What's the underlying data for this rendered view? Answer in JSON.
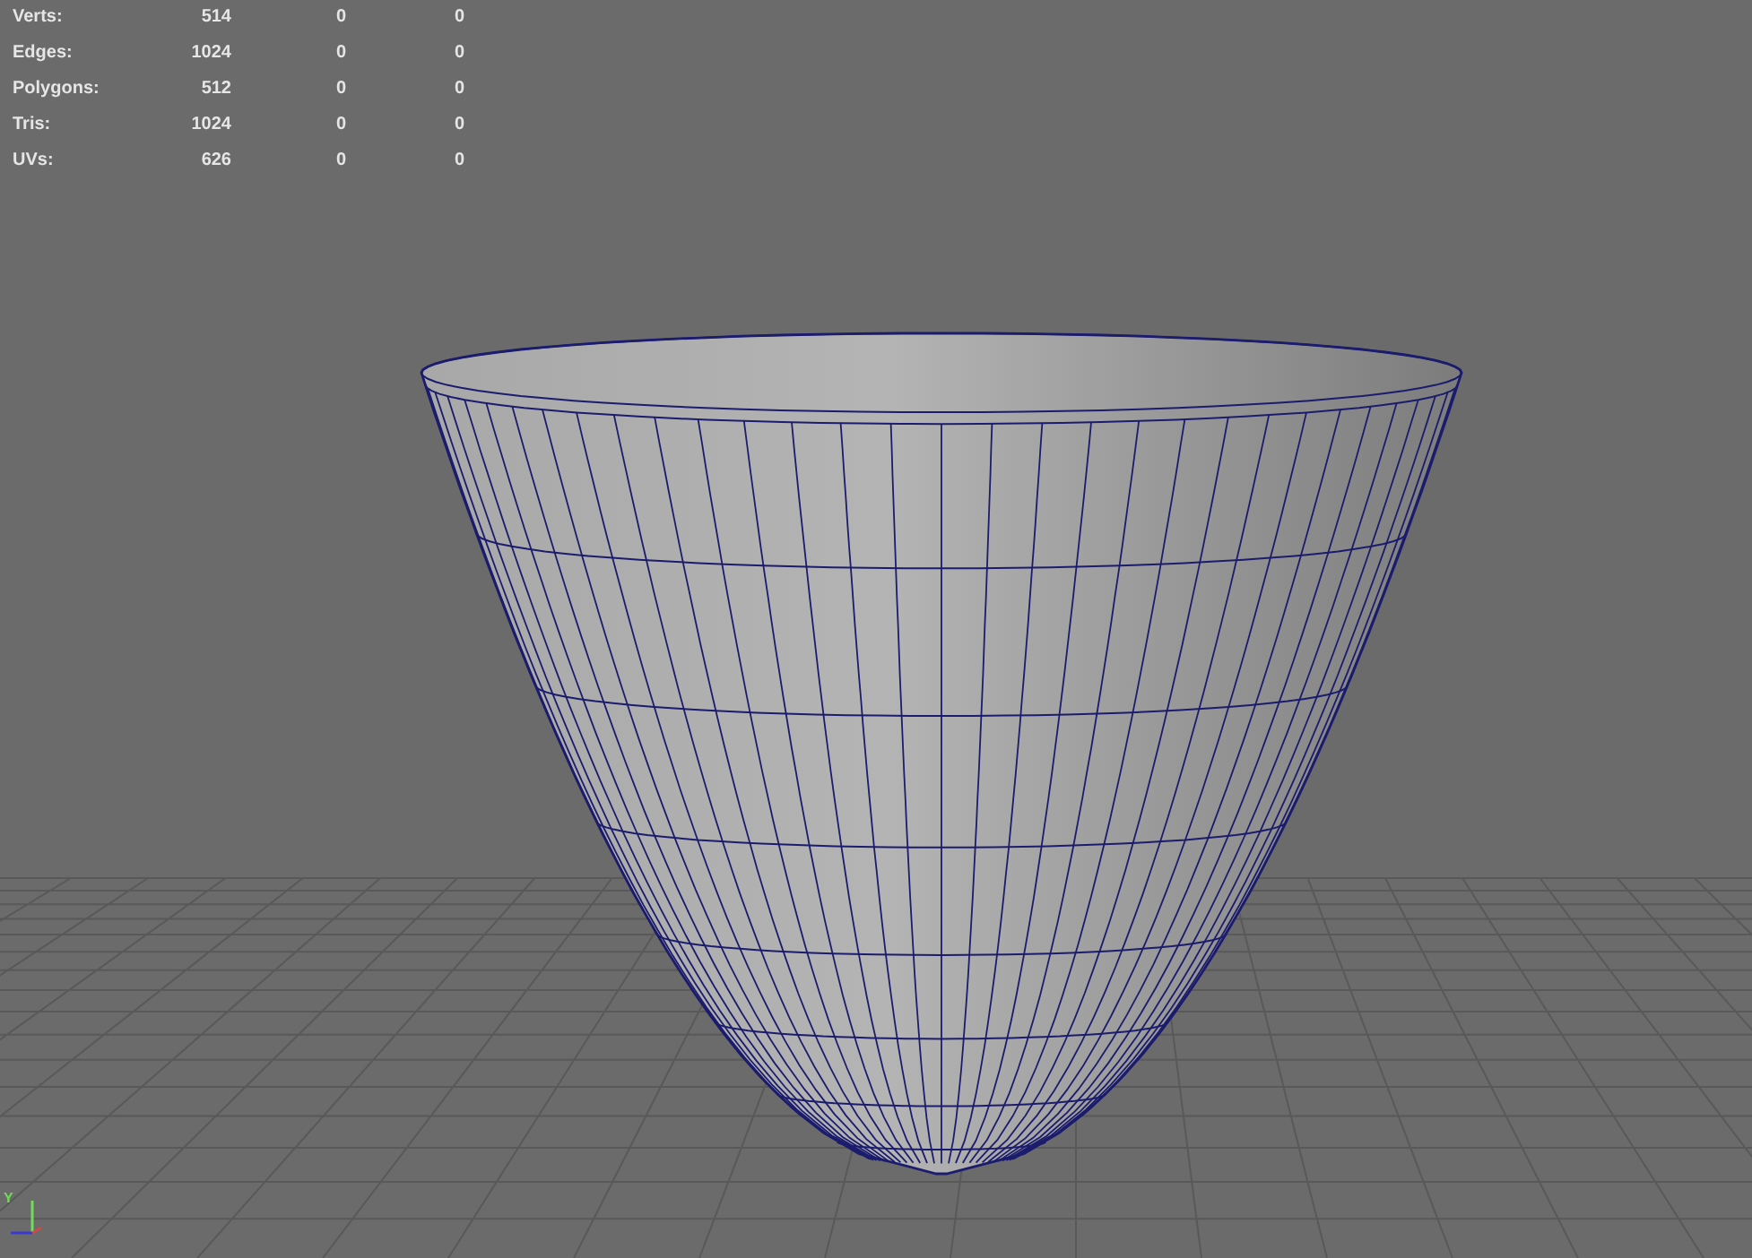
{
  "hud": {
    "rows": [
      {
        "label": "Verts:",
        "values": [
          "514",
          "0",
          "0"
        ]
      },
      {
        "label": "Edges:",
        "values": [
          "1024",
          "0",
          "0"
        ]
      },
      {
        "label": "Polygons:",
        "values": [
          "512",
          "0",
          "0"
        ]
      },
      {
        "label": "Tris:",
        "values": [
          "1024",
          "0",
          "0"
        ]
      },
      {
        "label": "UVs:",
        "values": [
          "626",
          "0",
          "0"
        ]
      }
    ]
  },
  "axis_gizmo": {
    "label": "Y"
  }
}
